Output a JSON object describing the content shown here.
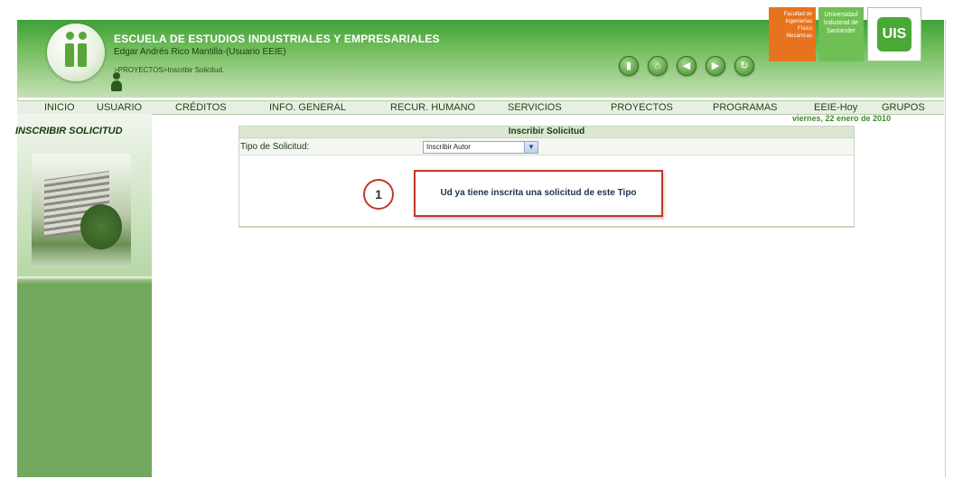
{
  "header": {
    "school_name": "ESCUELA DE ESTUDIOS INDUSTRIALES Y EMPRESARIALES",
    "user_line": "Edgar Andrés Rico Mantilla-(Usuario EEIE)",
    "breadcrumb": ">PROYECTOS>Inscribir Solicitud.",
    "logo_faculty": "Facultad de Ingenierías Físico Mecánicas",
    "logo_university": "Universidad Industrial de Santander",
    "logo_mark": "UIS",
    "toolbar_icons": [
      "book-icon",
      "home-icon",
      "back-icon",
      "forward-icon",
      "exit-icon"
    ]
  },
  "nav": {
    "items": [
      {
        "label": "INICIO"
      },
      {
        "label": "USUARIO"
      },
      {
        "label": "CRÉDITOS"
      },
      {
        "label": "INFO. GENERAL"
      },
      {
        "label": "RECUR. HUMANO"
      },
      {
        "label": "SERVICIOS"
      },
      {
        "label": "PROYECTOS"
      },
      {
        "label": "PROGRAMAS"
      },
      {
        "label": "EEIE-Hoy"
      },
      {
        "label": "GRUPOS"
      }
    ]
  },
  "date": "viernes, 22 enero de 2010",
  "sidebar": {
    "title": "INSCRIBIR SOLICITUD"
  },
  "form": {
    "title": "Inscribir Solicitud",
    "type_label": "Tipo de Solicitud:",
    "type_value": "Inscribir Autor",
    "message": "Ud ya tiene inscrita una solicitud de este Tipo",
    "callout_number": "1"
  },
  "colors": {
    "header_green": "#3fa038",
    "nav_background": "#e7efe2",
    "callout_red": "#c0392b",
    "faculty_orange": "#e8731f"
  }
}
